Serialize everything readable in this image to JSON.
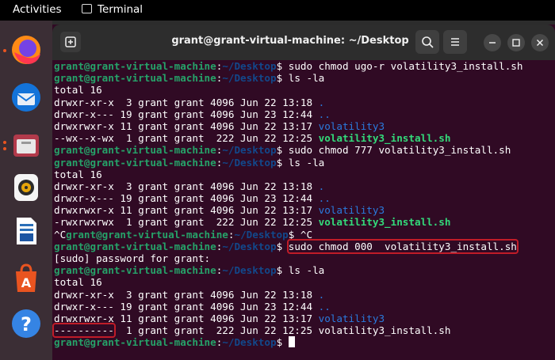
{
  "topbar": {
    "activities": "Activities",
    "app_name": "Terminal"
  },
  "window": {
    "title": "grant@grant-virtual-machine: ~/Desktop"
  },
  "prompt": {
    "user": "grant@grant-virtual-machine",
    "sep": ":",
    "path": "~/Desktop",
    "sym": "$ "
  },
  "lines": [
    {
      "kind": "cmd",
      "cmd": "sudo chmod ugo-r volatility3_install.sh"
    },
    {
      "kind": "cmd",
      "cmd": "ls -la"
    },
    {
      "kind": "text",
      "text": "total 16"
    },
    {
      "kind": "ls",
      "meta": "drwxr-xr-x  3 grant grant 4096 Jun 22 13:18 ",
      "name": ".",
      "style": "d"
    },
    {
      "kind": "ls",
      "meta": "drwxr-x--- 19 grant grant 4096 Jun 23 12:44 ",
      "name": "..",
      "style": "d"
    },
    {
      "kind": "ls",
      "meta": "drwxrwxr-x 11 grant grant 4096 Jun 22 13:17 ",
      "name": "volatility3",
      "style": "d"
    },
    {
      "kind": "ls",
      "meta": "--wx--x-wx  1 grant grant  222 Jun 22 12:25 ",
      "name": "volatility3_install.sh",
      "style": "g"
    },
    {
      "kind": "cmd",
      "cmd": "sudo chmod 777 volatility3_install.sh"
    },
    {
      "kind": "cmd",
      "cmd": "ls -la"
    },
    {
      "kind": "text",
      "text": "total 16"
    },
    {
      "kind": "ls",
      "meta": "drwxr-xr-x  3 grant grant 4096 Jun 22 13:18 ",
      "name": ".",
      "style": "d"
    },
    {
      "kind": "ls",
      "meta": "drwxr-x--- 19 grant grant 4096 Jun 23 12:44 ",
      "name": "..",
      "style": "d"
    },
    {
      "kind": "ls",
      "meta": "drwxrwxr-x 11 grant grant 4096 Jun 22 13:17 ",
      "name": "volatility3",
      "style": "d"
    },
    {
      "kind": "ls",
      "meta": "-rwxrwxrwx  1 grant grant  222 Jun 22 12:25 ",
      "name": "volatility3_install.sh",
      "style": "g"
    },
    {
      "kind": "cmd",
      "pre": "^C",
      "cmd": "^C"
    },
    {
      "kind": "cmd",
      "cmd": "sudo chmod 000  volatility3_install.sh",
      "highlight": true
    },
    {
      "kind": "text",
      "text": "[sudo] password for grant:"
    },
    {
      "kind": "cmd",
      "cmd": "ls -la"
    },
    {
      "kind": "text",
      "text": "total 16"
    },
    {
      "kind": "ls",
      "meta": "drwxr-xr-x  3 grant grant 4096 Jun 22 13:18 ",
      "name": ".",
      "style": "d"
    },
    {
      "kind": "ls",
      "meta": "drwxr-x--- 19 grant grant 4096 Jun 23 12:44 ",
      "name": "..",
      "style": "d"
    },
    {
      "kind": "ls",
      "meta": "drwxrwxr-x 11 grant grant 4096 Jun 22 13:17 ",
      "name": "volatility3",
      "style": "d"
    },
    {
      "kind": "ls",
      "perm": "----------",
      "meta": "  1 grant grant  222 Jun 22 12:25 ",
      "name": "volatility3_install.sh",
      "style": "plain",
      "perm_highlight": true
    },
    {
      "kind": "cmd",
      "cmd": "",
      "cursor": true
    }
  ]
}
